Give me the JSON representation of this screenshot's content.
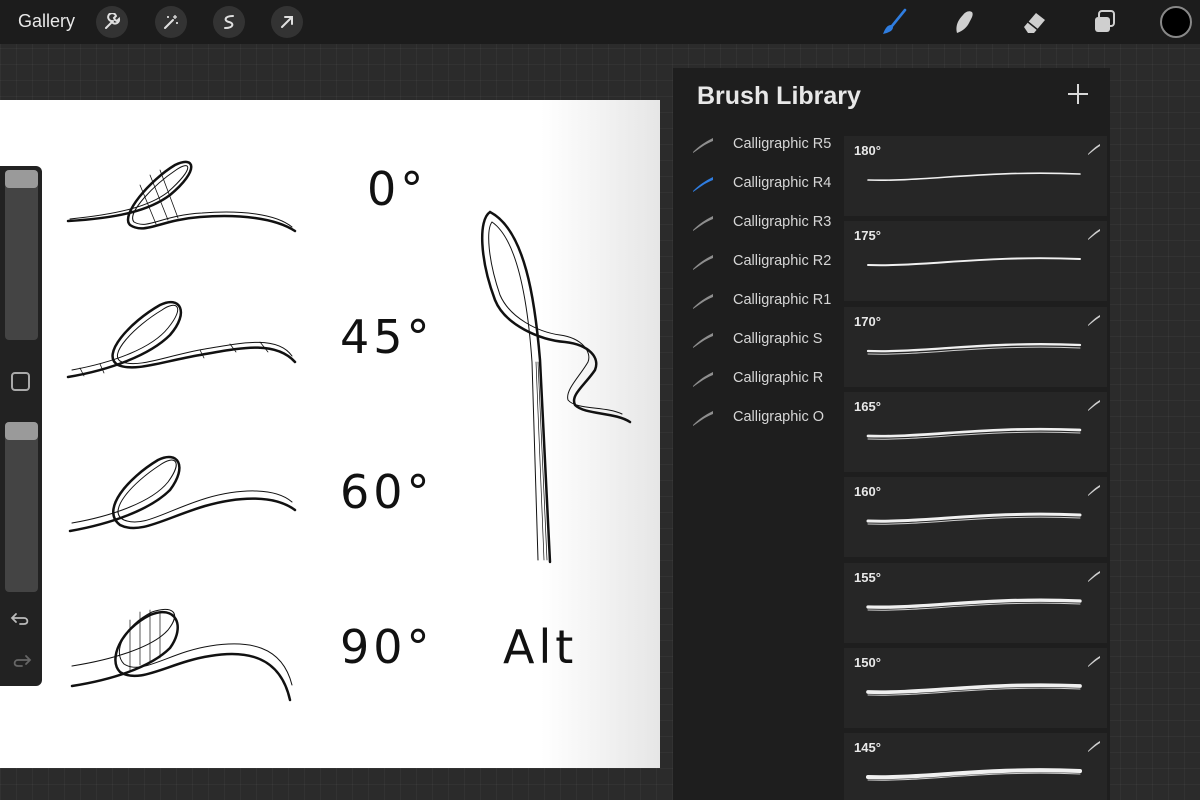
{
  "topbar": {
    "gallery_label": "Gallery",
    "left_tools": [
      "wrench-icon",
      "magic-wand-icon",
      "selection-icon",
      "transform-arrow-icon"
    ],
    "right_tools": [
      "brush-icon",
      "smudge-icon",
      "eraser-icon",
      "layers-icon"
    ],
    "active_tool_color": "#2f7de0",
    "current_color": "#000000"
  },
  "canvas": {
    "labels": [
      "0°",
      "45°",
      "60°",
      "90°",
      "Alt"
    ]
  },
  "brush_library": {
    "title": "Brush Library",
    "selected_index": 1,
    "brushes": [
      "Calligraphic R5",
      "Calligraphic R4",
      "Calligraphic R3",
      "Calligraphic R2",
      "Calligraphic R1",
      "Calligraphic S",
      "Calligraphic R",
      "Calligraphic O"
    ],
    "variants": [
      "180°",
      "175°",
      "170°",
      "165°",
      "160°",
      "155°",
      "150°",
      "145°"
    ]
  }
}
